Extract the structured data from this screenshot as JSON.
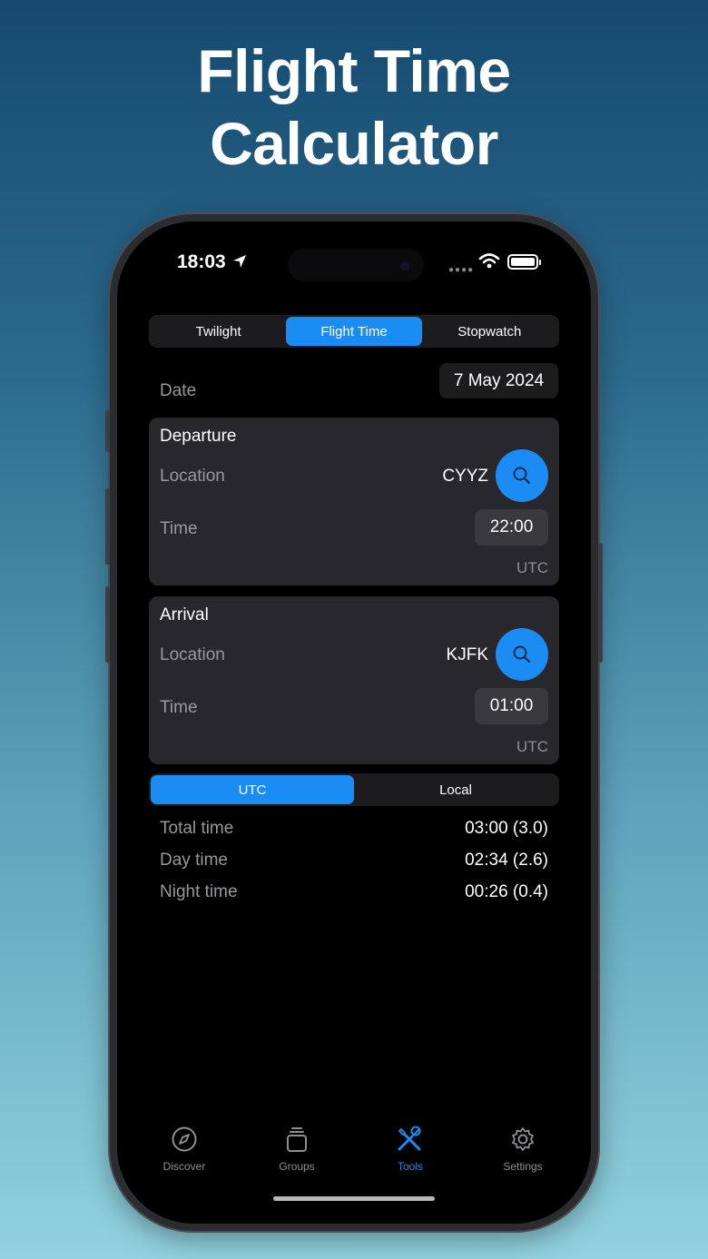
{
  "headline": {
    "line1": "Flight Time",
    "line2": "Calculator"
  },
  "status_bar": {
    "time": "18:03"
  },
  "mode_tabs": [
    {
      "label": "Twilight",
      "active": false
    },
    {
      "label": "Flight Time",
      "active": true
    },
    {
      "label": "Stopwatch",
      "active": false
    }
  ],
  "date": {
    "label": "Date",
    "value": "7 May 2024"
  },
  "departure": {
    "title": "Departure",
    "location_label": "Location",
    "location_value": "CYYZ",
    "time_label": "Time",
    "time_value": "22:00",
    "timezone": "UTC"
  },
  "arrival": {
    "title": "Arrival",
    "location_label": "Location",
    "location_value": "KJFK",
    "time_label": "Time",
    "time_value": "01:00",
    "timezone": "UTC"
  },
  "tz_toggle": [
    {
      "label": "UTC",
      "active": true
    },
    {
      "label": "Local",
      "active": false
    }
  ],
  "results": [
    {
      "label": "Total time",
      "value": "03:00 (3.0)"
    },
    {
      "label": "Day time",
      "value": "02:34 (2.6)"
    },
    {
      "label": "Night time",
      "value": "00:26 (0.4)"
    }
  ],
  "tab_bar": [
    {
      "label": "Discover",
      "icon": "compass-icon",
      "active": false
    },
    {
      "label": "Groups",
      "icon": "stack-icon",
      "active": false
    },
    {
      "label": "Tools",
      "icon": "tools-icon",
      "active": true
    },
    {
      "label": "Settings",
      "icon": "gear-icon",
      "active": false
    }
  ],
  "colors": {
    "accent": "#1c8cf5",
    "card": "#28282c",
    "background": "#000000"
  }
}
